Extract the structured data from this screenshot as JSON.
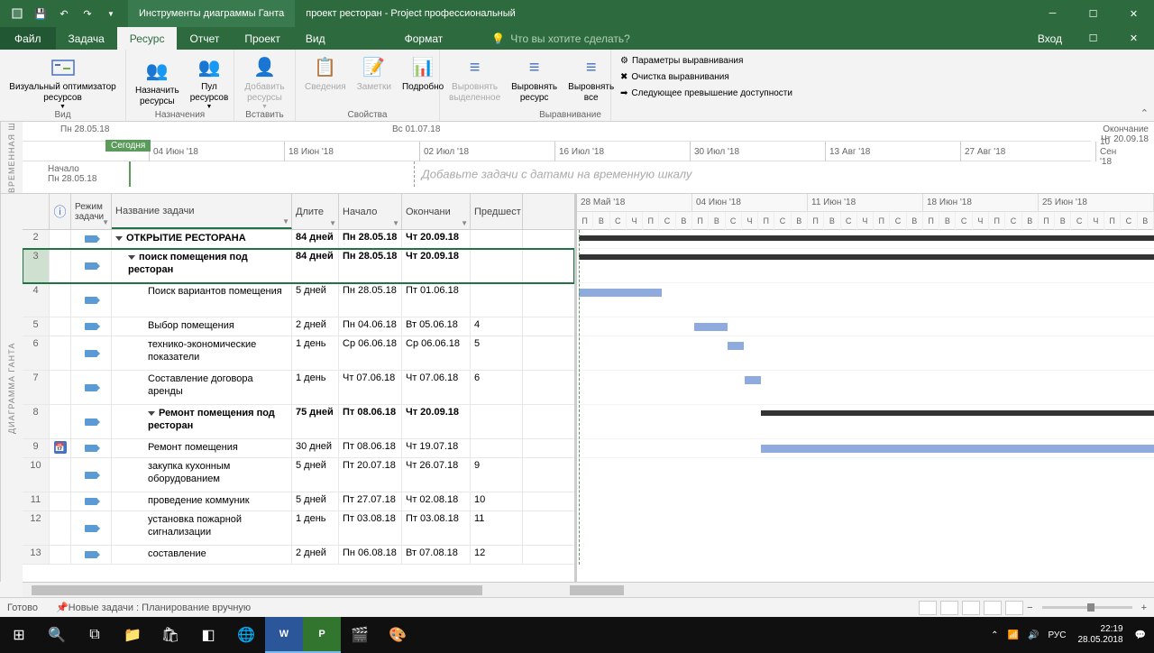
{
  "titlebar": {
    "tools_label": "Инструменты диаграммы Ганта",
    "doc_title": "проект ресторан - Project профессиональный"
  },
  "ribbon_tabs": {
    "file": "Файл",
    "task": "Задача",
    "resource": "Ресурс",
    "report": "Отчет",
    "project": "Проект",
    "view": "Вид",
    "format": "Формат",
    "tell_me": "Что вы хотите сделать?",
    "signin": "Вход"
  },
  "ribbon": {
    "visual_optimizer": "Визуальный оптимизатор ресурсов",
    "group_view": "Вид",
    "assign_res": "Назначить ресурсы",
    "pool_res": "Пул ресурсов",
    "add_res": "Добавить ресурсы",
    "group_assign": "Назначения",
    "group_insert": "Вставить",
    "details": "Сведения",
    "notes": "Заметки",
    "details_btn": "Подробно",
    "group_props": "Свойства",
    "level_sel": "Выровнять выделенное",
    "level_res": "Выровнять ресурс",
    "level_all": "Выровнять все",
    "level_opts": "Параметры выравнивания",
    "clear_level": "Очистка выравнивания",
    "next_over": "Следующее превышение доступности",
    "group_level": "Выравнивание"
  },
  "timeline": {
    "start_date": "Пн 28.05.18",
    "start_label": "Начало",
    "today": "Сегодня",
    "ticks": [
      "04 Июн '18",
      "18 Июн '18",
      "02 Июл '18",
      "16 Июл '18",
      "30 Июл '18",
      "13 Авг '18",
      "27 Авг '18",
      "10 Сен '18"
    ],
    "vs_date": "Вс 01.07.18",
    "placeholder": "Добавьте задачи с датами на временную шкалу",
    "finish_label": "Окончание",
    "finish_date": "Чт 20.09.18",
    "side_label": "ВРЕМЕННАЯ Ш"
  },
  "grid": {
    "side_label": "ДИАГРАММА ГАНТА",
    "headers": {
      "info": "ⓘ",
      "mode": "Режим задачи",
      "name": "Название задачи",
      "duration": "Длите",
      "start": "Начало",
      "finish": "Окончани",
      "pred": "Предшест"
    },
    "rows": [
      {
        "num": "2",
        "name": "ОТКРЫТИЕ РЕСТОРАНА",
        "dur": "84 дней",
        "start": "Пн 28.05.18",
        "finish": "Чт 20.09.18",
        "pred": "",
        "bold": true,
        "indent": 0,
        "summary": true
      },
      {
        "num": "3",
        "name": "поиск помещения под ресторан",
        "dur": "84 дней",
        "start": "Пн 28.05.18",
        "finish": "Чт 20.09.18",
        "pred": "",
        "bold": true,
        "indent": 1,
        "summary": true,
        "selected": true,
        "tall": true
      },
      {
        "num": "4",
        "name": "Поиск вариантов помещения",
        "dur": "5 дней",
        "start": "Пн 28.05.18",
        "finish": "Пт 01.06.18",
        "pred": "",
        "indent": 2,
        "tall": true
      },
      {
        "num": "5",
        "name": "Выбор помещения",
        "dur": "2 дней",
        "start": "Пн 04.06.18",
        "finish": "Вт 05.06.18",
        "pred": "4",
        "indent": 2
      },
      {
        "num": "6",
        "name": "технико-экономические показатели",
        "dur": "1 день",
        "start": "Ср 06.06.18",
        "finish": "Ср 06.06.18",
        "pred": "5",
        "indent": 2,
        "tall": true
      },
      {
        "num": "7",
        "name": "Составление договора аренды",
        "dur": "1 день",
        "start": "Чт 07.06.18",
        "finish": "Чт 07.06.18",
        "pred": "6",
        "indent": 2,
        "tall": true
      },
      {
        "num": "8",
        "name": "Ремонт помещения под ресторан",
        "dur": "75 дней",
        "start": "Пт 08.06.18",
        "finish": "Чт 20.09.18",
        "pred": "",
        "bold": true,
        "indent": 2,
        "summary": true,
        "tall": true
      },
      {
        "num": "9",
        "name": "Ремонт помещения",
        "dur": "30 дней",
        "start": "Пт 08.06.18",
        "finish": "Чт 19.07.18",
        "pred": "",
        "indent": 2,
        "info": true
      },
      {
        "num": "10",
        "name": "закупка кухонным оборудованием",
        "dur": "5 дней",
        "start": "Пт 20.07.18",
        "finish": "Чт 26.07.18",
        "pred": "9",
        "indent": 2,
        "tall": true
      },
      {
        "num": "11",
        "name": "проведение коммуник",
        "dur": "5 дней",
        "start": "Пт 27.07.18",
        "finish": "Чт 02.08.18",
        "pred": "10",
        "indent": 2
      },
      {
        "num": "12",
        "name": "установка пожарной сигнализации",
        "dur": "1 день",
        "start": "Пт 03.08.18",
        "finish": "Пт 03.08.18",
        "pred": "11",
        "indent": 2,
        "tall": true
      },
      {
        "num": "13",
        "name": "составление",
        "dur": "2 дней",
        "start": "Пн 06.08.18",
        "finish": "Вт 07.08.18",
        "pred": "12",
        "indent": 2
      }
    ]
  },
  "chart": {
    "weeks": [
      "28 Май '18",
      "04 Июн '18",
      "11 Июн '18",
      "18 Июн '18",
      "25 Июн '18"
    ],
    "days": [
      "П",
      "В",
      "С",
      "Ч",
      "П",
      "С",
      "В"
    ]
  },
  "statusbar": {
    "ready": "Готово",
    "new_tasks": "Новые задачи : Планирование вручную"
  },
  "taskbar": {
    "time": "22:19",
    "date": "28.05.2018",
    "lang": "РУС"
  }
}
